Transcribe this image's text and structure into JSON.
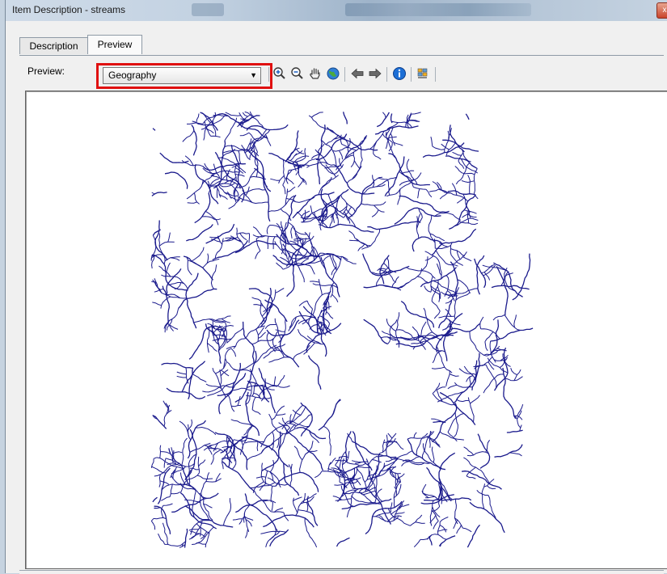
{
  "window": {
    "title": "Item Description - streams",
    "close_glyph": "x"
  },
  "tabs": [
    {
      "label": "Description",
      "active": false
    },
    {
      "label": "Preview",
      "active": true
    }
  ],
  "preview": {
    "label": "Preview:",
    "selected": "Geography",
    "highlight_color": "#e01010"
  },
  "toolbar": {
    "buttons": [
      {
        "name": "zoom-in-icon",
        "glyph": "⊕"
      },
      {
        "name": "zoom-out-icon",
        "glyph": "⊖"
      },
      {
        "name": "pan-hand-icon",
        "glyph": "✋"
      },
      {
        "name": "full-extent-globe-icon",
        "glyph": "●"
      },
      {
        "name": "back-arrow-icon",
        "glyph": "⇦"
      },
      {
        "name": "forward-arrow-icon",
        "glyph": "⇨"
      },
      {
        "name": "identify-info-icon",
        "glyph": "i"
      },
      {
        "name": "generate-thumbnail-icon",
        "glyph": "▦"
      }
    ]
  },
  "map": {
    "stream_color": "#1a1a8c",
    "background": "#ffffff"
  }
}
